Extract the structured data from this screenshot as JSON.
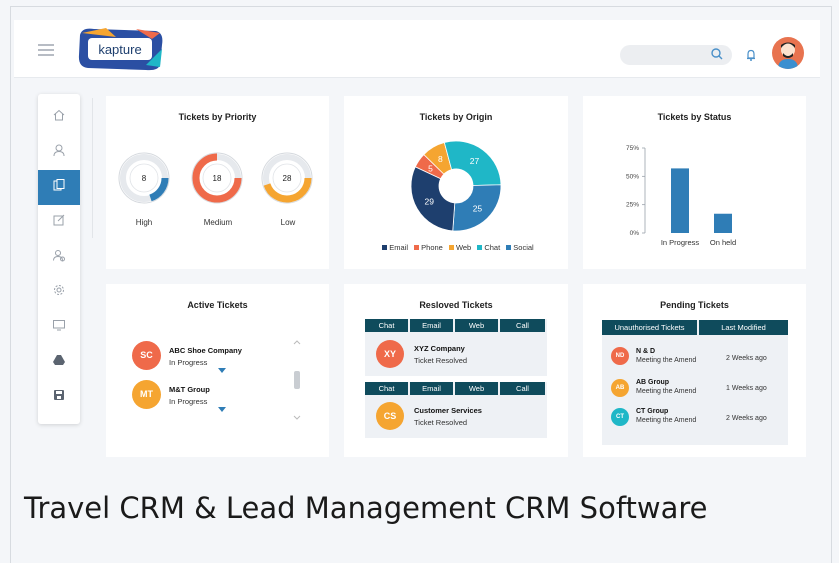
{
  "app": {
    "logo_text": "kapture"
  },
  "cards": {
    "priority": {
      "title": "Tickets by Priority",
      "items": [
        {
          "label": "High",
          "value": "8",
          "fraction": 0.2,
          "color": "#2f7db6"
        },
        {
          "label": "Medium",
          "value": "18",
          "fraction": 0.75,
          "color": "#ef6a4a"
        },
        {
          "label": "Low",
          "value": "28",
          "fraction": 0.45,
          "color": "#f5a531"
        }
      ]
    },
    "origin": {
      "title": "Tickets by Origin",
      "slices": [
        {
          "name": "Email",
          "value": 29,
          "color": "#1e3f6e"
        },
        {
          "name": "Phone",
          "value": 5,
          "color": "#ef6a4a"
        },
        {
          "name": "Web",
          "value": 8,
          "color": "#f5a531"
        },
        {
          "name": "Chat",
          "value": 27,
          "color": "#1fb7c7"
        },
        {
          "name": "Social",
          "value": 25,
          "color": "#2f7db6"
        }
      ],
      "legend": [
        "Email",
        "Phone",
        "Web",
        "Chat",
        "Social"
      ]
    },
    "status": {
      "title": "Tickets by Status",
      "y_ticks": [
        "75%",
        "50%",
        "25%",
        "0%"
      ],
      "categories": [
        "In Progress",
        "On held"
      ],
      "values": [
        57,
        17
      ],
      "color": "#2f7db6"
    },
    "active": {
      "title": "Active Tickets",
      "items": [
        {
          "initials": "SC",
          "name": "ABC Shoe Company",
          "status": "In Progress",
          "color": "#ef6a4a"
        },
        {
          "initials": "MT",
          "name": "M&T Group",
          "status": "In Progress",
          "color": "#f5a531"
        }
      ]
    },
    "resolved": {
      "title": "Resloved Tickets",
      "tabs": [
        "Chat",
        "Email",
        "Web",
        "Call"
      ],
      "items": [
        {
          "initials": "XY",
          "name": "XYZ Company",
          "status": "Ticket Resolved",
          "color": "#ef6a4a"
        },
        {
          "initials": "CS",
          "name": "Customer Services",
          "status": "Ticket Resolved",
          "color": "#f5a531"
        }
      ]
    },
    "pending": {
      "title": "Pending Tickets",
      "headers": [
        "Unauthorised Tickets",
        "Last Modified"
      ],
      "items": [
        {
          "initials": "ND",
          "name": "N & D",
          "sub": "Meeting the Amend",
          "time": "2 Weeks ago",
          "color": "#ef6a4a"
        },
        {
          "initials": "AB",
          "name": "AB Group",
          "sub": "Meeting the Amend",
          "time": "1 Weeks ago",
          "color": "#f5a531"
        },
        {
          "initials": "CT",
          "name": "CT Group",
          "sub": "Meeting the Amend",
          "time": "2 Weeks ago",
          "color": "#1fb7c7"
        }
      ]
    }
  },
  "sidebar": [
    "home-icon",
    "user-icon",
    "documents-icon",
    "edit-icon",
    "contacts-icon",
    "settings-icon",
    "monitor-icon",
    "drive-icon",
    "save-icon"
  ],
  "caption": "Travel CRM & Lead Management CRM Software"
}
